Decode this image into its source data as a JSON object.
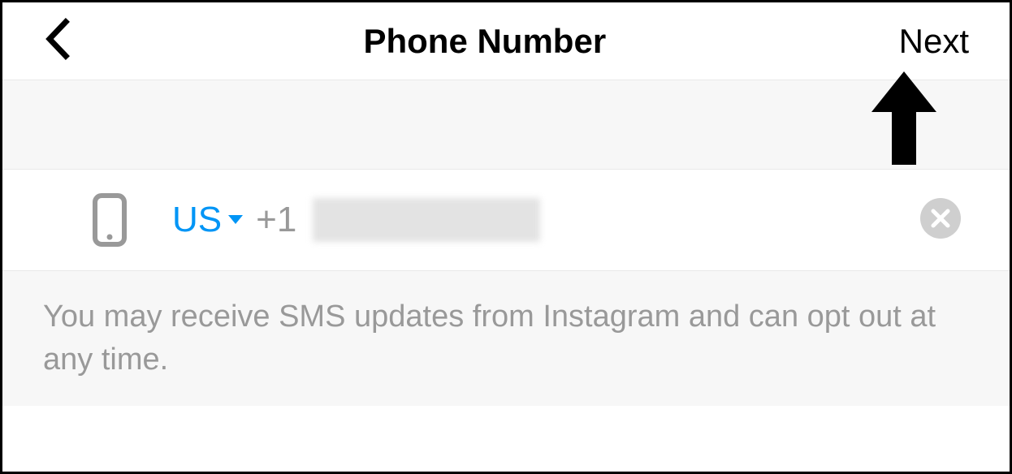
{
  "header": {
    "title": "Phone Number",
    "next_label": "Next"
  },
  "phone_input": {
    "country_code": "US",
    "dial_code": "+1",
    "value": ""
  },
  "helper_text": "You may receive SMS updates from Instagram and can opt out at any time.",
  "icons": {
    "back": "chevron-left-icon",
    "phone": "phone-icon",
    "caret": "caret-down-icon",
    "clear": "clear-icon"
  }
}
